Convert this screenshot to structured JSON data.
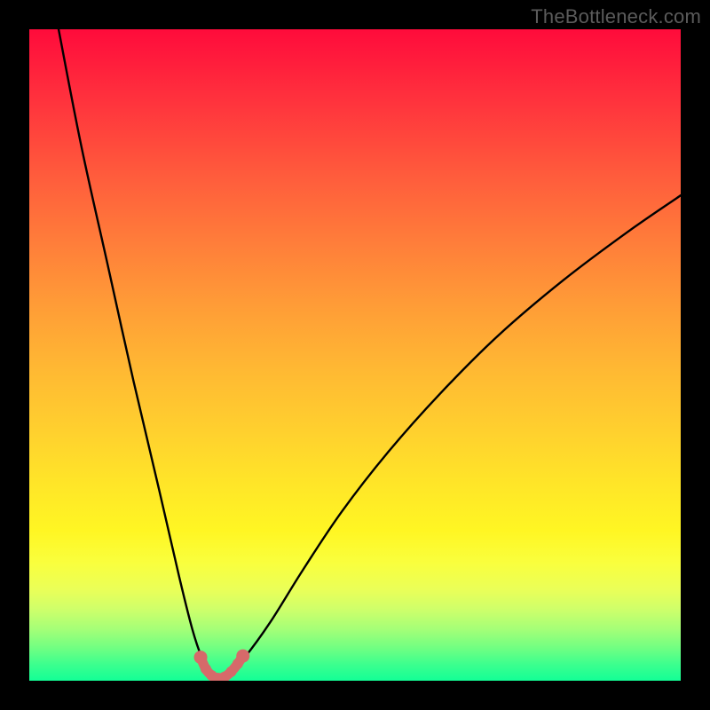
{
  "watermark": "TheBottleneck.com",
  "colors": {
    "background": "#000000",
    "gradient_top": "#ff0b3b",
    "gradient_mid": "#ffd12e",
    "gradient_bottom": "#13ff96",
    "curve": "#000000",
    "valley_highlight": "#d66a6a"
  },
  "chart_data": {
    "type": "line",
    "title": "",
    "xlabel": "",
    "ylabel": "",
    "xlim": [
      0,
      100
    ],
    "ylim": [
      0,
      100
    ],
    "grid": false,
    "legend": false,
    "valley_x": 29,
    "highlighted_region_x": [
      26,
      33
    ],
    "series": [
      {
        "name": "left-branch",
        "x": [
          4.5,
          8,
          12,
          16,
          20,
          23,
          25,
          26.5,
          27.8,
          28.8
        ],
        "y": [
          100,
          82,
          64,
          46,
          29,
          16,
          8,
          3.5,
          1.2,
          0.4
        ]
      },
      {
        "name": "right-branch",
        "x": [
          29.2,
          30.5,
          33,
          37,
          42,
          48,
          55,
          63,
          72,
          82,
          92,
          100
        ],
        "y": [
          0.4,
          1.0,
          3.5,
          9,
          17,
          26,
          35,
          44,
          53,
          61.5,
          69,
          74.5
        ]
      },
      {
        "name": "valley-highlight",
        "x": [
          26.3,
          27.1,
          28.0,
          29.0,
          30.0,
          31.0,
          32.0,
          32.8
        ],
        "y": [
          3.6,
          1.8,
          0.8,
          0.4,
          0.6,
          1.4,
          2.6,
          3.8
        ]
      }
    ]
  }
}
